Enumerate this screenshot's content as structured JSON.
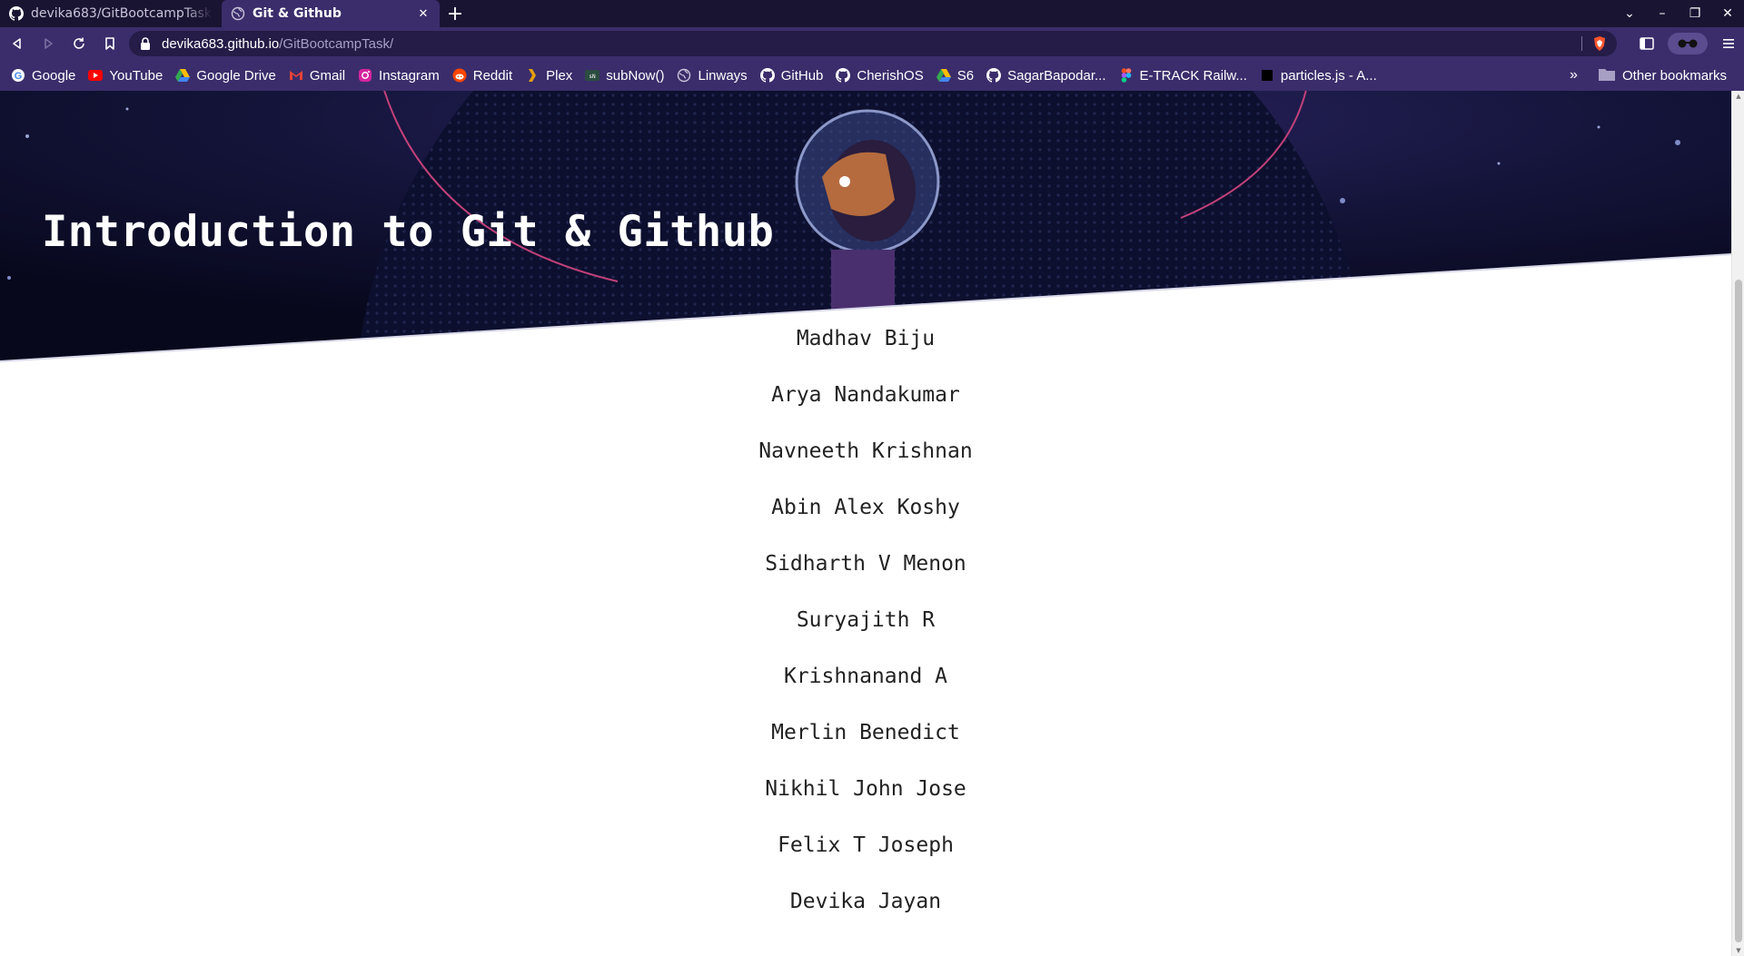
{
  "browser": {
    "tabs": [
      {
        "title": "devika683/GitBootcampTask",
        "active": false,
        "icon": "github-icon"
      },
      {
        "title": "Git & Github",
        "active": true,
        "icon": "globe-icon"
      }
    ],
    "new_tab_label": "+",
    "window_controls": {
      "minimize": "–",
      "restore": "❐",
      "close": "✕",
      "tab_search": "⌄"
    },
    "address": {
      "host": "devika683.github.io",
      "path": "/GitBootcampTask/"
    },
    "bookmarks": [
      {
        "label": "Google",
        "icon": "google-icon"
      },
      {
        "label": "YouTube",
        "icon": "youtube-icon"
      },
      {
        "label": "Google Drive",
        "icon": "google-drive-icon"
      },
      {
        "label": "Gmail",
        "icon": "gmail-icon"
      },
      {
        "label": "Instagram",
        "icon": "instagram-icon"
      },
      {
        "label": "Reddit",
        "icon": "reddit-icon"
      },
      {
        "label": "Plex",
        "icon": "plex-icon"
      },
      {
        "label": "subNow()",
        "icon": "subnow-icon"
      },
      {
        "label": "Linways",
        "icon": "globe-icon"
      },
      {
        "label": "GitHub",
        "icon": "github-icon"
      },
      {
        "label": "CherishOS",
        "icon": "github-icon"
      },
      {
        "label": "S6",
        "icon": "google-drive-icon"
      },
      {
        "label": "SagarBapodar...",
        "icon": "github-icon"
      },
      {
        "label": "E-TRACK Railw...",
        "icon": "figma-icon"
      },
      {
        "label": "particles.js - A...",
        "icon": "codepen-icon"
      }
    ],
    "bookmarks_more": "»",
    "other_bookmarks": "Other bookmarks"
  },
  "page": {
    "title": "Introduction to Git & Github",
    "names": [
      "Madhav Biju",
      "Arya Nandakumar",
      "Navneeth Krishnan",
      "Abin Alex Koshy",
      "Sidharth V Menon",
      "Suryajith R",
      "Krishnanand A",
      "Merlin Benedict",
      "Nikhil John Jose",
      "Felix T Joseph",
      "Devika Jayan"
    ]
  },
  "colors": {
    "tab_strip": "#1a1433",
    "toolbar": "#3b2d6b",
    "hero_dark": "#0b0c24",
    "page_bg": "#ffffff",
    "name_text": "#222222"
  }
}
